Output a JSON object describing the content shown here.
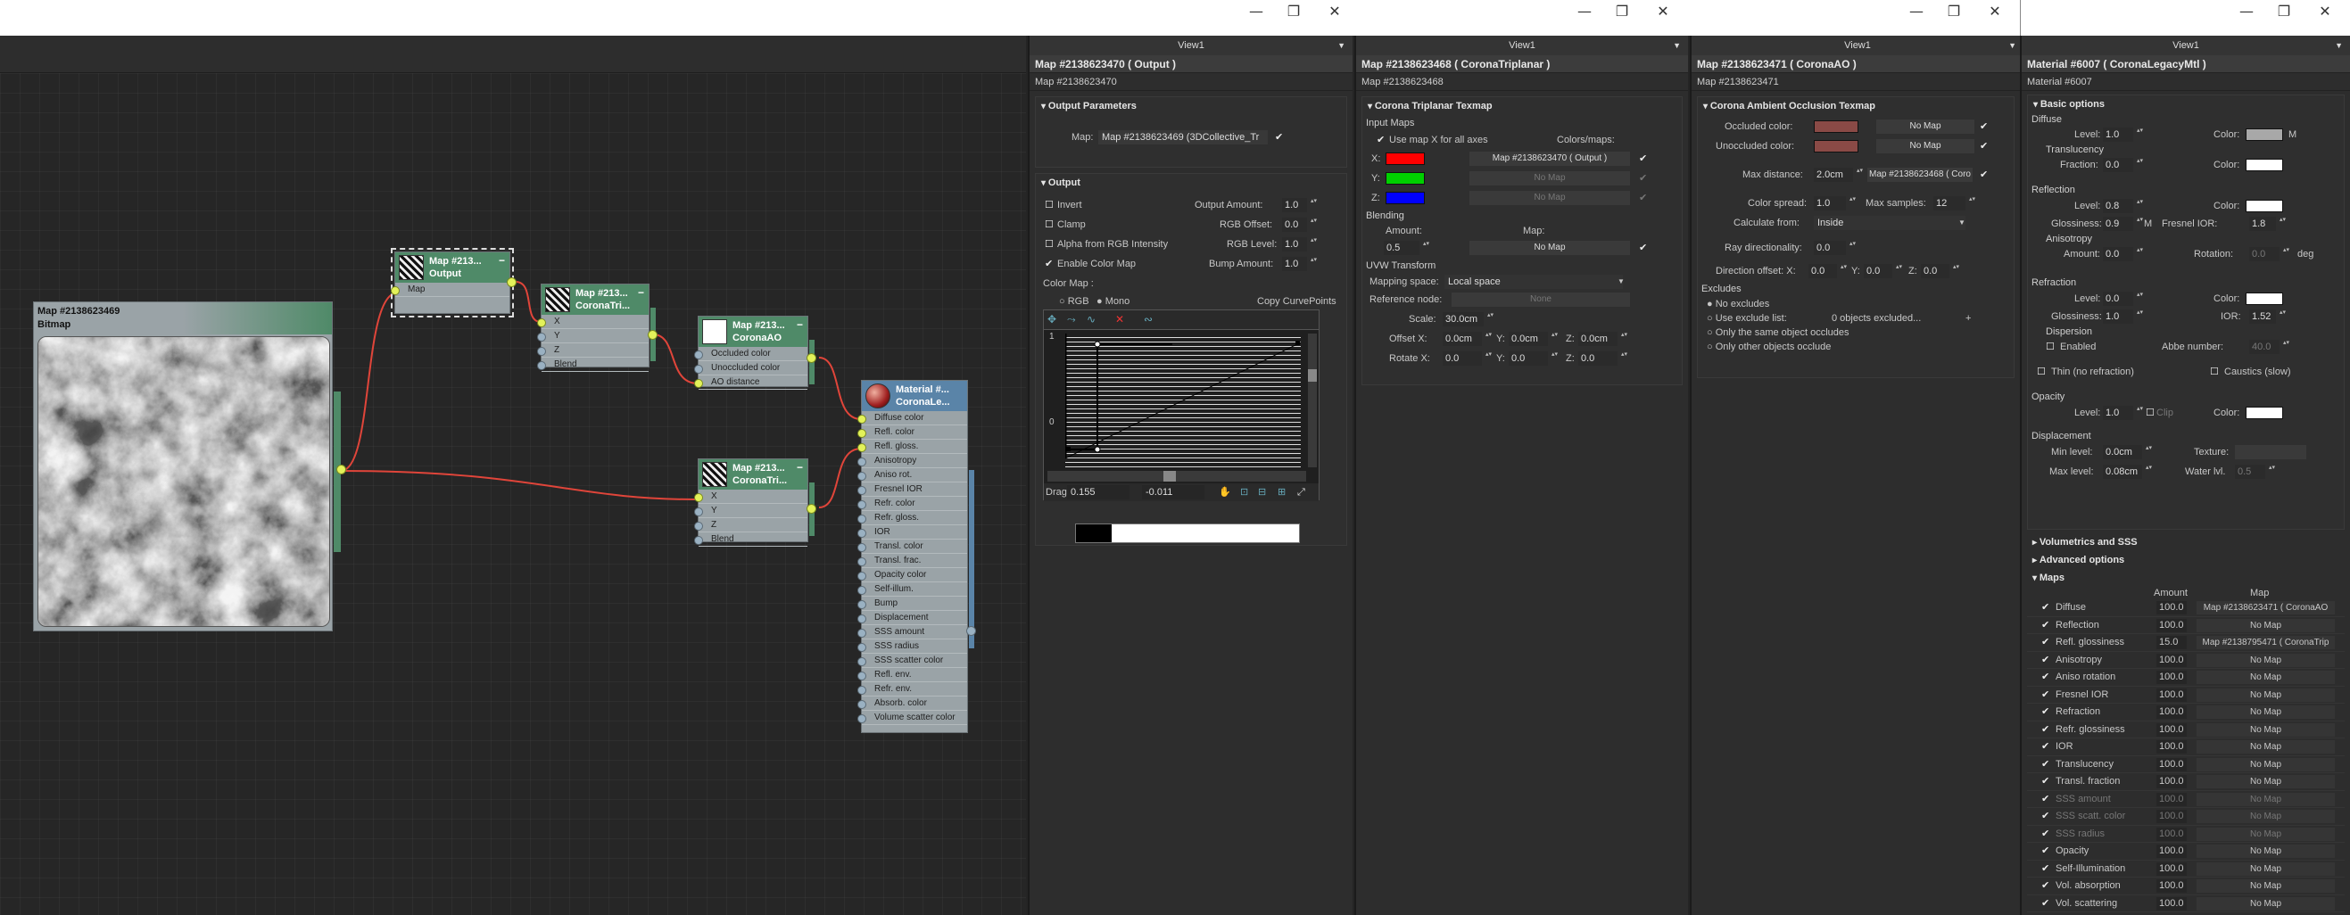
{
  "window": {
    "minimize": "—",
    "restore": "❐",
    "close": "✕"
  },
  "views": [
    "View1",
    "View1",
    "View1",
    "View1"
  ],
  "nodes": {
    "bitmap": {
      "title": "Map #2138623469",
      "sub": "Bitmap",
      "icon": "bitmap-thumbnail"
    },
    "output": {
      "title": "Map #213...",
      "sub": "Output",
      "ports": [
        "Map"
      ]
    },
    "triplanar1": {
      "title": "Map #213...",
      "sub": "CoronaTri...",
      "ports": [
        "X",
        "Y",
        "Z",
        "Blend"
      ]
    },
    "ao": {
      "title": "Map #213...",
      "sub": "CoronaAO",
      "ports": [
        "Occluded color",
        "Unoccluded color",
        "AO distance"
      ]
    },
    "triplanar2": {
      "title": "Map #213...",
      "sub": "CoronaTri...",
      "ports": [
        "X",
        "Y",
        "Z",
        "Blend"
      ]
    },
    "material": {
      "title": "Material #...",
      "sub": "CoronaLe...",
      "ports": [
        "Diffuse color",
        "Refl. color",
        "Refl. gloss.",
        "Anisotropy",
        "Aniso rot.",
        "Fresnel IOR",
        "Refr. color",
        "Refr. gloss.",
        "IOR",
        "Transl. color",
        "Transl. frac.",
        "Opacity color",
        "Self-illum.",
        "Bump",
        "Displacement",
        "SSS amount",
        "SSS radius",
        "SSS scatter color",
        "Refl. env.",
        "Refr. env.",
        "Absorb. color",
        "Volume scatter color"
      ]
    }
  },
  "output_panel": {
    "title": "Map #2138623470  ( Output )",
    "name": "Map #2138623470",
    "r_output_params": "Output Parameters",
    "map_label": "Map:",
    "map_value": "Map #2138623469 (3DCollective_Tr",
    "r_output": "Output",
    "invert": "Invert",
    "clamp": "Clamp",
    "alpha_rgb": "Alpha from RGB Intensity",
    "enable_color_map": "Enable Color Map",
    "output_amount_label": "Output Amount:",
    "output_amount": "1.0",
    "rgb_offset_label": "RGB Offset:",
    "rgb_offset": "0.0",
    "rgb_level_label": "RGB Level:",
    "rgb_level": "1.0",
    "bump_amount_label": "Bump Amount:",
    "bump_amount": "1.0",
    "color_map_label": "Color Map :",
    "rgb": "RGB",
    "mono": "Mono",
    "copy_curve": "Copy CurvePoints",
    "axis_top": "1",
    "axis_bottom": "0",
    "drag_label": "Drag",
    "drag_x": "0.155",
    "drag_y": "-0.011"
  },
  "tri_panel": {
    "title": "Map #2138623468  ( CoronaTriplanar )",
    "name": "Map #2138623468",
    "rollout": "Corona Triplanar Texmap",
    "input_maps": "Input Maps",
    "use_x": "Use map X for all axes",
    "colors_maps": "Colors/maps:",
    "x": "X:",
    "y": "Y:",
    "z": "Z:",
    "x_map": "Map #2138623470  ( Output )",
    "y_map": "No Map",
    "z_map": "No Map",
    "blending": "Blending",
    "amount_label": "Amount:",
    "amount": "0.5",
    "map_label": "Map:",
    "blend_map": "No Map",
    "uvw": "UVW Transform",
    "mapping_space_label": "Mapping space:",
    "mapping_space": "Local space",
    "ref_node_label": "Reference node:",
    "ref_node": "None",
    "scale_label": "Scale:",
    "scale": "30.0cm",
    "offset_label": "Offset X:",
    "offx": "0.0cm",
    "offy_label": "Y:",
    "offy": "0.0cm",
    "offz_label": "Z:",
    "offz": "0.0cm",
    "rotate_label": "Rotate X:",
    "rotx": "0.0",
    "roty_label": "Y:",
    "roty": "0.0",
    "rotz_label": "Z:",
    "rotz": "0.0"
  },
  "ao_panel": {
    "title": "Map #2138623471  ( CoronaAO )",
    "name": "Map #2138623471",
    "rollout": "Corona Ambient Occlusion Texmap",
    "occluded_label": "Occluded color:",
    "occluded_map": "No Map",
    "unoccluded_label": "Unoccluded color:",
    "unoccluded_map": "No Map",
    "max_dist_label": "Max distance:",
    "max_dist": "2.0cm",
    "max_dist_map": "Map #2138623468  ( Coro",
    "color_spread_label": "Color spread:",
    "color_spread": "1.0",
    "max_samples_label": "Max samples:",
    "max_samples": "12",
    "calc_from_label": "Calculate from:",
    "calc_from": "Inside",
    "ray_dir_label": "Ray directionality:",
    "ray_dir": "0.0",
    "dir_offset_label": "Direction offset: X:",
    "dox": "0.0",
    "doy_label": "Y:",
    "doy": "0.0",
    "doz_label": "Z:",
    "doz": "0.0",
    "excludes": "Excludes",
    "no_excludes": "No excludes",
    "use_exclude": "Use exclude list:",
    "excluded": "0 objects excluded...",
    "plus": "+",
    "only_same": "Only the same object occludes",
    "only_other": "Only other objects occlude",
    "occluded_color": "#8a4a46",
    "unoccluded_color": "#8a4a46"
  },
  "mat_panel": {
    "title": "Material #6007  ( CoronaLegacyMtl )",
    "name": "Material #6007",
    "basic": "Basic options",
    "diffuse": "Diffuse",
    "level_label": "Level:",
    "diff_level": "1.0",
    "color_label": "Color:",
    "diff_m": "M",
    "translucency": "Translucency",
    "fraction_label": "Fraction:",
    "transl_frac": "0.0",
    "reflection": "Reflection",
    "refl_level": "0.8",
    "glossiness_label": "Glossiness:",
    "refl_gloss": "0.9",
    "gloss_m": "M",
    "fresnel_label": "Fresnel IOR:",
    "fresnel": "1.8",
    "anisotropy": "Anisotropy",
    "aniso_amount_label": "Amount:",
    "aniso_amount": "0.0",
    "rotation_label": "Rotation:",
    "rotation": "0.0",
    "deg": "deg",
    "refraction": "Refraction",
    "refr_level": "0.0",
    "refr_gloss": "1.0",
    "ior_label": "IOR:",
    "ior": "1.52",
    "dispersion": "Dispersion",
    "enabled": "Enabled",
    "abbe_label": "Abbe number:",
    "abbe": "40.0",
    "thin": "Thin (no refraction)",
    "caustics": "Caustics (slow)",
    "opacity": "Opacity",
    "op_level": "1.0",
    "clip": "Clip",
    "displacement": "Displacement",
    "min_level_label": "Min level:",
    "min_level": "0.0cm",
    "texture_label": "Texture:",
    "max_level_label": "Max level:",
    "max_level": "0.08cm",
    "water_label": "Water lvl.",
    "water": "0.5",
    "vol_sss": "Volumetrics and SSS",
    "advanced": "Advanced options",
    "maps": "Maps",
    "amount_col": "Amount",
    "map_col": "Map",
    "map_rows": [
      {
        "name": "Diffuse",
        "amount": "100.0",
        "map": "Map #2138623471  ( CoronaAO",
        "dim": false
      },
      {
        "name": "Reflection",
        "amount": "100.0",
        "map": "No Map",
        "dim": false
      },
      {
        "name": "Refl. glossiness",
        "amount": "15.0",
        "map": "Map #2138795471  ( CoronaTrip",
        "dim": false
      },
      {
        "name": "Anisotropy",
        "amount": "100.0",
        "map": "No Map",
        "dim": false
      },
      {
        "name": "Aniso rotation",
        "amount": "100.0",
        "map": "No Map",
        "dim": false
      },
      {
        "name": "Fresnel IOR",
        "amount": "100.0",
        "map": "No Map",
        "dim": false
      },
      {
        "name": "Refraction",
        "amount": "100.0",
        "map": "No Map",
        "dim": false
      },
      {
        "name": "Refr. glossiness",
        "amount": "100.0",
        "map": "No Map",
        "dim": false
      },
      {
        "name": "IOR",
        "amount": "100.0",
        "map": "No Map",
        "dim": false
      },
      {
        "name": "Translucency",
        "amount": "100.0",
        "map": "No Map",
        "dim": false
      },
      {
        "name": "Transl. fraction",
        "amount": "100.0",
        "map": "No Map",
        "dim": false
      },
      {
        "name": "SSS amount",
        "amount": "100.0",
        "map": "No Map",
        "dim": true
      },
      {
        "name": "SSS scatt. color",
        "amount": "100.0",
        "map": "No Map",
        "dim": true
      },
      {
        "name": "SSS radius",
        "amount": "100.0",
        "map": "No Map",
        "dim": true
      },
      {
        "name": "Opacity",
        "amount": "100.0",
        "map": "No Map",
        "dim": false
      },
      {
        "name": "Self-Illumination",
        "amount": "100.0",
        "map": "No Map",
        "dim": false
      },
      {
        "name": "Vol. absorption",
        "amount": "100.0",
        "map": "No Map",
        "dim": false
      },
      {
        "name": "Vol. scattering",
        "amount": "100.0",
        "map": "No Map",
        "dim": false
      }
    ]
  },
  "colors": {
    "node_header": "#4f8a68",
    "wire": "#e0453a",
    "x_swatch": "#ff0000",
    "y_swatch": "#00d000",
    "z_swatch": "#0000ff"
  }
}
